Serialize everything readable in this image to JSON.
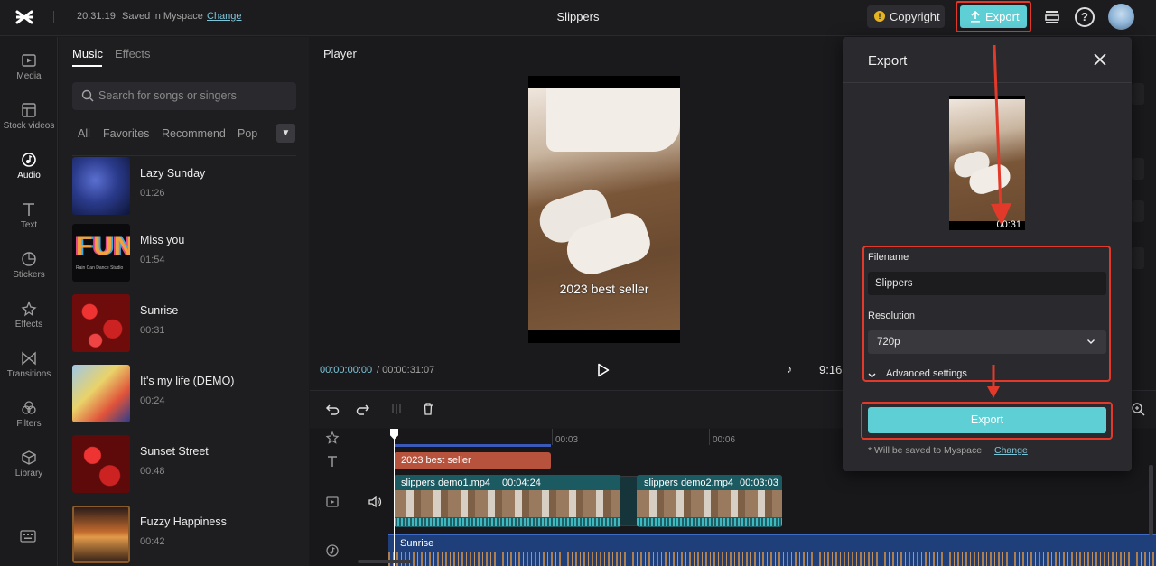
{
  "topbar": {
    "time": "20:31:19",
    "saved_text": "Saved in Myspace",
    "change_link": "Change",
    "project_title": "Slippers",
    "copyright_label": "Copyright",
    "export_label": "Export"
  },
  "iconbar": {
    "items": [
      {
        "label": "Media",
        "icon": "media-icon"
      },
      {
        "label": "Stock videos",
        "icon": "stock-videos-icon"
      },
      {
        "label": "Audio",
        "icon": "audio-icon"
      },
      {
        "label": "Text",
        "icon": "text-icon"
      },
      {
        "label": "Stickers",
        "icon": "stickers-icon"
      },
      {
        "label": "Effects",
        "icon": "effects-icon"
      },
      {
        "label": "Transitions",
        "icon": "transitions-icon"
      },
      {
        "label": "Filters",
        "icon": "filters-icon"
      },
      {
        "label": "Library",
        "icon": "library-icon"
      }
    ]
  },
  "panel": {
    "tabs": [
      "Music",
      "Effects"
    ],
    "search_placeholder": "Search for songs or singers",
    "filters": [
      "All",
      "Favorites",
      "Recommend",
      "Pop"
    ],
    "songs": [
      {
        "name": "Lazy Sunday",
        "duration": "01:26"
      },
      {
        "name": "Miss you",
        "duration": "01:54"
      },
      {
        "name": "Sunrise",
        "duration": "00:31"
      },
      {
        "name": "It's my life (DEMO)",
        "duration": "00:24"
      },
      {
        "name": "Sunset Street",
        "duration": "00:48"
      },
      {
        "name": "Fuzzy Happiness",
        "duration": "00:42"
      }
    ],
    "thumb_text": {
      "fun": "FUN",
      "fun_sub": "Rain Can Dance Studio"
    }
  },
  "player": {
    "title": "Player",
    "caption": "2023 best seller",
    "current_time": "00:00:00:00",
    "total_time": "/  00:00:31:07",
    "aspect_ratio": "9:16"
  },
  "timeline": {
    "ruler": [
      "00:03",
      "00:06"
    ],
    "text_clip": "2023 best seller",
    "clips": [
      {
        "name": "slippers demo1.mp4",
        "duration": "00:04:24"
      },
      {
        "name": "slippers demo2.mp4",
        "duration": "00:03:03"
      }
    ],
    "audio_clip": "Sunrise"
  },
  "dialog": {
    "title": "Export",
    "thumb_duration": "00:31",
    "filename_label": "Filename",
    "filename_value": "Slippers",
    "resolution_label": "Resolution",
    "resolution_value": "720p",
    "advanced_label": "Advanced settings",
    "export_button": "Export",
    "save_note": "* Will be saved to Myspace",
    "change_link": "Change"
  },
  "colors": {
    "accent": "#5ecfd5",
    "highlight": "#e2392a",
    "link": "#7dc5d8"
  }
}
